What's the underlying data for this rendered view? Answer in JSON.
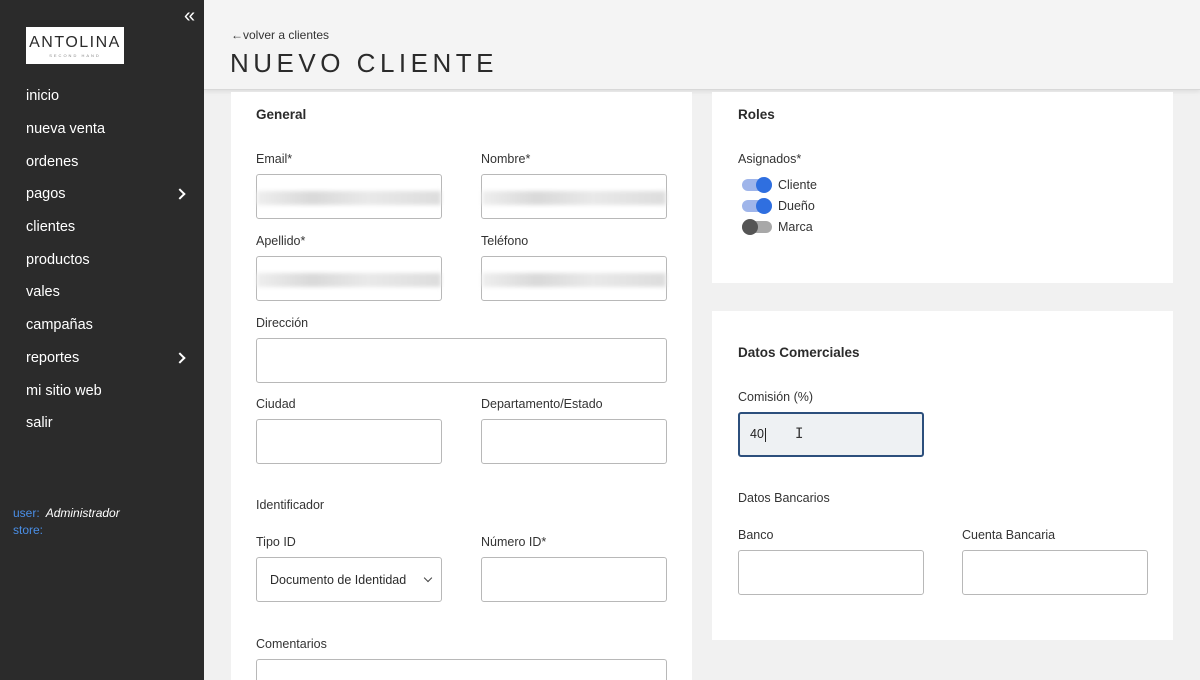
{
  "sidebar": {
    "collapse_icon": "«",
    "logo": {
      "text": "ANTOLINA",
      "subtext": "SECOND HAND"
    },
    "items": [
      {
        "label": "inicio",
        "has_submenu": false
      },
      {
        "label": "nueva venta",
        "has_submenu": false
      },
      {
        "label": "ordenes",
        "has_submenu": false
      },
      {
        "label": "pagos",
        "has_submenu": true
      },
      {
        "label": "clientes",
        "has_submenu": false
      },
      {
        "label": "productos",
        "has_submenu": false
      },
      {
        "label": "vales",
        "has_submenu": false
      },
      {
        "label": "campañas",
        "has_submenu": false
      },
      {
        "label": "reportes",
        "has_submenu": true
      },
      {
        "label": "mi sitio web",
        "has_submenu": false
      },
      {
        "label": "salir",
        "has_submenu": false
      }
    ],
    "user_label": "user:",
    "user_value": "Administrador",
    "store_label": "store:",
    "store_value": ""
  },
  "header": {
    "back_link": "←volver a clientes",
    "title": "NUEVO CLIENTE"
  },
  "general": {
    "title": "General",
    "email_label": "Email*",
    "nombre_label": "Nombre*",
    "apellido_label": "Apellido*",
    "telefono_label": "Teléfono",
    "direccion_label": "Dirección",
    "ciudad_label": "Ciudad",
    "departamento_label": "Departamento/Estado",
    "identificador_title": "Identificador",
    "tipo_id_label": "Tipo ID",
    "tipo_id_value": "Documento de Identidad",
    "numero_id_label": "Número ID*",
    "comentarios_label": "Comentarios"
  },
  "roles": {
    "title": "Roles",
    "asignados_label": "Asignados*",
    "toggles": [
      {
        "label": "Cliente",
        "on": true
      },
      {
        "label": "Dueño",
        "on": true
      },
      {
        "label": "Marca",
        "on": false
      }
    ]
  },
  "datos": {
    "title": "Datos Comerciales",
    "comision_label": "Comisión (%)",
    "comision_value": "40",
    "bancarios_title": "Datos Bancarios",
    "banco_label": "Banco",
    "cuenta_label": "Cuenta Bancaria"
  },
  "colors": {
    "sidebar_bg": "#2b2b2b",
    "accent": "#2f6fe0",
    "user_key": "#4a8fe7"
  }
}
